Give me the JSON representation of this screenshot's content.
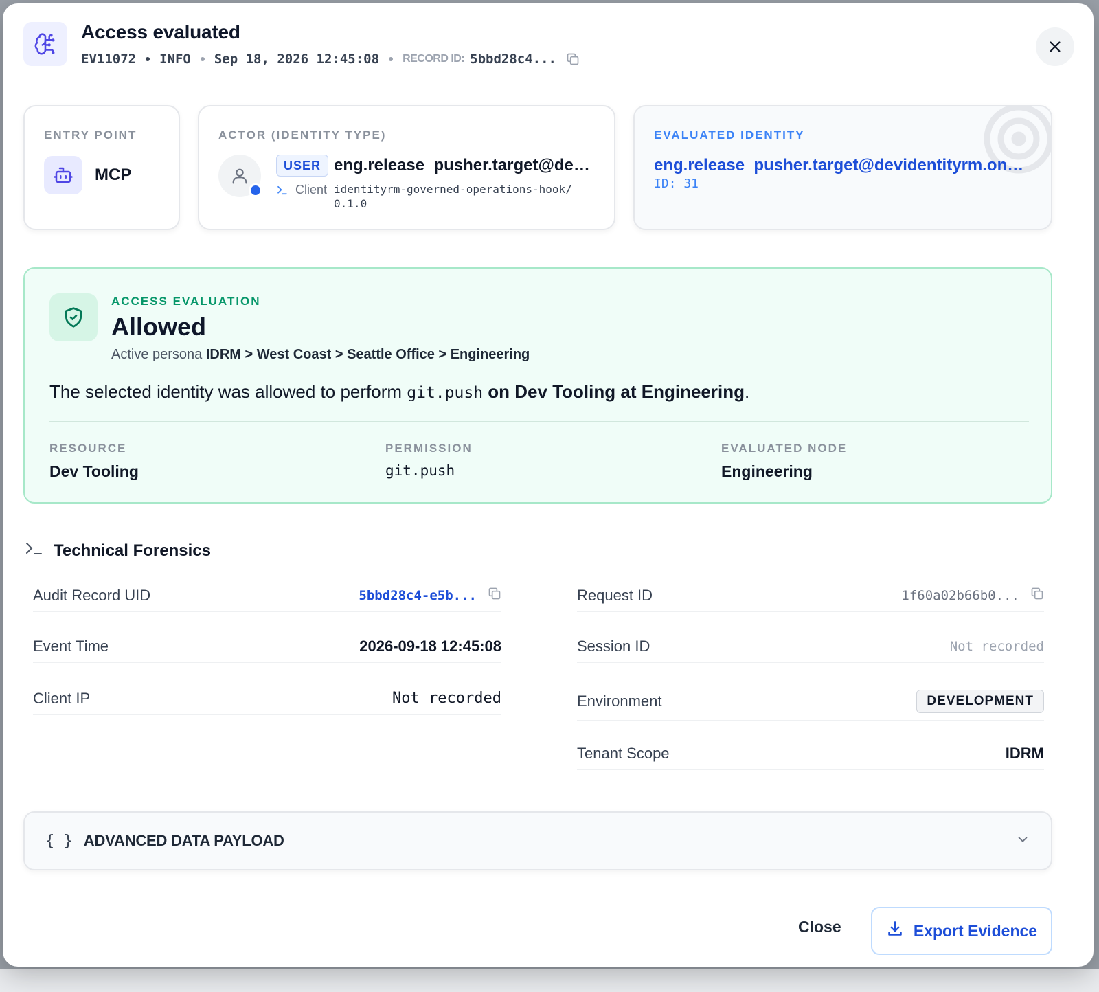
{
  "header": {
    "title": "Access evaluated",
    "event_code": "EV11072",
    "level": "INFO",
    "timestamp": "Sep 18, 2026 12:45:08",
    "record_label": "RECORD ID:",
    "record_id": "5bbd28c4...",
    "icon": "brain-circuit-icon"
  },
  "cards": {
    "entry_point": {
      "label": "ENTRY POINT",
      "value": "MCP",
      "icon": "bot-icon"
    },
    "actor": {
      "label": "ACTOR (IDENTITY TYPE)",
      "type_badge": "USER",
      "email": "eng.release_pusher.target@devi...",
      "client_label": "Client",
      "client_value": "identityrm-governed-operations-hook/0.1.0"
    },
    "evaluated_identity": {
      "label": "EVALUATED IDENTITY",
      "email": "eng.release_pusher.target@devidentityrm.onmi...",
      "id_text": "ID: 31"
    }
  },
  "access": {
    "label": "ACCESS EVALUATION",
    "status": "Allowed",
    "persona_prefix": "Active persona",
    "persona_path": "IDRM > West Coast > Seattle Office > Engineering",
    "sentence": {
      "prefix": "The selected identity was allowed to perform",
      "permission": "git.push",
      "on": "on",
      "resource": "Dev Tooling",
      "at": "at",
      "node": "Engineering",
      "end": "."
    },
    "details": {
      "resource_label": "RESOURCE",
      "resource_value": "Dev Tooling",
      "permission_label": "PERMISSION",
      "permission_value": "git.push",
      "node_label": "EVALUATED NODE",
      "node_value": "Engineering"
    },
    "accent": "#059669"
  },
  "forensics": {
    "title": "Technical Forensics",
    "left": {
      "audit_uid_label": "Audit Record UID",
      "audit_uid_value": "5bbd28c4-e5b...",
      "event_time_label": "Event Time",
      "event_time_value": "2026-09-18 12:45:08",
      "client_ip_label": "Client IP",
      "client_ip_value": "Not recorded"
    },
    "right": {
      "request_id_label": "Request ID",
      "request_id_value": "1f60a02b66b0...",
      "session_id_label": "Session ID",
      "session_id_value": "Not recorded",
      "environment_label": "Environment",
      "environment_value": "DEVELOPMENT",
      "tenant_label": "Tenant Scope",
      "tenant_value": "IDRM"
    }
  },
  "payload": {
    "braces": "{ }",
    "label": "ADVANCED DATA PAYLOAD"
  },
  "footer": {
    "close_label": "Close",
    "export_label": "Export Evidence"
  },
  "colors": {
    "primary": "#1d4ed8",
    "success": "#059669",
    "muted": "#8a919c"
  }
}
